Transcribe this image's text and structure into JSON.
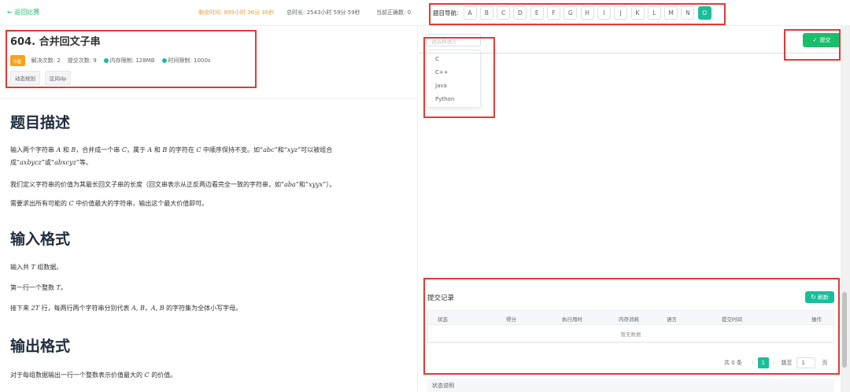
{
  "topbar": {
    "back": "← 返回比赛",
    "remaining": "剩余时间: 899小时 36分 36秒",
    "total": "总时长: 2543小时 59分 59秒",
    "correct": "当前正确数: 0"
  },
  "nav": {
    "label": "题目导航:",
    "items": [
      "A",
      "B",
      "C",
      "D",
      "E",
      "F",
      "G",
      "H",
      "I",
      "J",
      "K",
      "L",
      "M",
      "N",
      "O"
    ],
    "active": "O"
  },
  "problem": {
    "title": "604. 合并回文子串",
    "level": "6星",
    "solved": "解决次数: 2",
    "submitted": "提交次数: 9",
    "memory": "内存限制: 128MB",
    "time": "时间限制: 1000s",
    "tags": [
      "动态规划",
      "区间dp"
    ]
  },
  "content": {
    "desc_heading": "题目描述",
    "desc_p1a": "输入两个字符串 ",
    "desc_p1b": " 和 ",
    "desc_p1c": "，合并成一个串 ",
    "desc_p1d": "，属于 ",
    "desc_p1e": " 和 ",
    "desc_p1f": " 的字符在 ",
    "desc_p1g": " 中顺序保持不变。如“",
    "desc_p1h": "”和“",
    "desc_p1i": "”可以被组合成“",
    "desc_p1j": "”或“",
    "desc_p1k": "”等。",
    "desc_p2a": "我们定义字符串的价值为其最长回文子串的长度（回文串表示从正反两边看完全一致的字符串，如“",
    "desc_p2b": "”和“",
    "desc_p2c": "”）。",
    "desc_p3a": "需要求出所有可能的 ",
    "desc_p3b": " 中价值最大的字符串，输出这个最大价值即可。",
    "input_heading": "输入格式",
    "in_p1a": "输入共 ",
    "in_p1b": " 组数据。",
    "in_p2a": "第一行一个整数 ",
    "in_p2b": "。",
    "in_p3a": "接下来 ",
    "in_p3b": " 行，每两行两个字符串分别代表 ",
    "in_p3c": "，",
    "in_p3d": " 的字符集为全体小写字母。",
    "output_heading": "输出格式",
    "out_p1a": "对于每组数据输出一行一个整数表示价值最大的 ",
    "out_p1b": " 的价值。",
    "m_A": "A",
    "m_B": "B",
    "m_C": "C",
    "m_T": "T",
    "m_2T": "2T",
    "m_AB": "A, B",
    "m_abc": "abc",
    "m_xyz": "xyz",
    "m_axbycz": "axbycz",
    "m_abxcyz": "abxcyz",
    "m_aba": "aba",
    "m_xyyx": "xyyx"
  },
  "editor": {
    "lang_placeholder": "请选择语言",
    "languages": [
      "C",
      "C++",
      "Java",
      "Python"
    ],
    "submit_label": "提交"
  },
  "records": {
    "title": "提交记录",
    "refresh_label": "刷新",
    "columns": [
      "状态",
      "得分",
      "执行用时",
      "内存消耗",
      "语言",
      "提交时间",
      "操作"
    ],
    "empty": "暂无数据",
    "total": "共 0 条",
    "current_page": "1",
    "goto_label": "跳至",
    "goto_value": "1",
    "page_suffix": "页",
    "status_note": "状态说明"
  },
  "colors": {
    "accent": "#19be9b",
    "green": "#19be6b",
    "warning": "#e6a23c",
    "annotation": "#e53935"
  }
}
